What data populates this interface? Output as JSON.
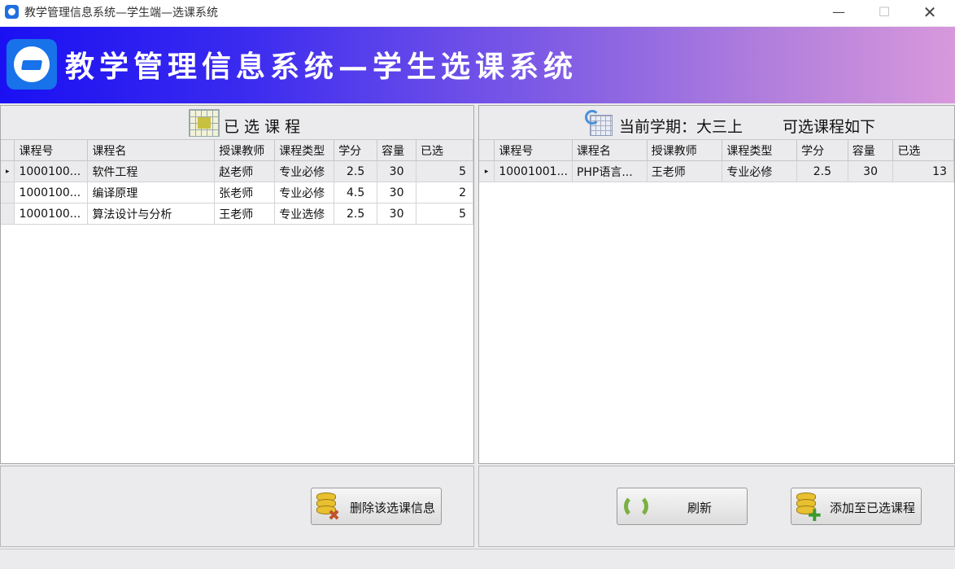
{
  "window": {
    "title": "教学管理信息系统—学生端—选课系统",
    "minimize_glyph": "—",
    "maximize_glyph": "☐",
    "close_glyph": "✕"
  },
  "banner": {
    "title": "教学管理信息系统—学生选课系统",
    "logo_icon": "graduation-cap-icon"
  },
  "selected_panel": {
    "header": "已 选 课 程",
    "icon": "table-grid-icon",
    "columns": [
      "课程号",
      "课程名",
      "授课教师",
      "课程类型",
      "学分",
      "容量",
      "已选"
    ],
    "rows": [
      [
        "1000100...",
        "软件工程",
        "赵老师",
        "专业必修",
        "2.5",
        "30",
        "5"
      ],
      [
        "1000100...",
        "编译原理",
        "张老师",
        "专业必修",
        "4.5",
        "30",
        "2"
      ],
      [
        "1000100...",
        "算法设计与分析",
        "王老师",
        "专业选修",
        "2.5",
        "30",
        "5"
      ]
    ],
    "current_row_marker": "▸"
  },
  "available_panel": {
    "header_semester": "当前学期：大三上",
    "header_label": "可选课程如下",
    "icon": "calendar-refresh-icon",
    "columns": [
      "课程号",
      "课程名",
      "授课教师",
      "课程类型",
      "学分",
      "容量",
      "已选"
    ],
    "rows": [
      [
        "10001001...",
        "PHP语言...",
        "王老师",
        "专业必修",
        "2.5",
        "30",
        "13"
      ]
    ],
    "current_row_marker": "▸"
  },
  "buttons": {
    "delete": "删除该选课信息",
    "refresh": "刷新",
    "add": "添加至已选课程"
  }
}
